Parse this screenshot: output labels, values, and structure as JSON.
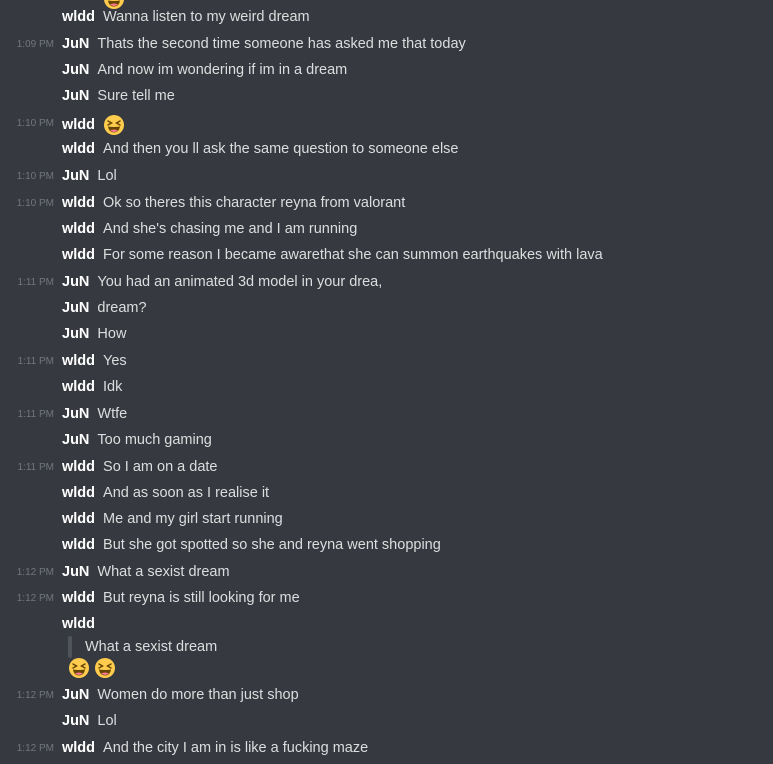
{
  "messages": [
    {
      "time": "",
      "author": "wldd",
      "text": "Wanna listen to my weird dream"
    },
    {
      "time": "1:09 PM",
      "author": "JuN",
      "text": "Thats the second time someone has asked me that today"
    },
    {
      "time": "",
      "author": "JuN",
      "text": "And now im wondering if im in a dream"
    },
    {
      "time": "",
      "author": "JuN",
      "text": "Sure tell me"
    },
    {
      "time": "1:10 PM",
      "author": "wldd",
      "text": ""
    },
    {
      "time": "",
      "author": "wldd",
      "text": "And then you ll ask the same question to someone else"
    },
    {
      "time": "1:10 PM",
      "author": "JuN",
      "text": "Lol"
    },
    {
      "time": "1:10 PM",
      "author": "wldd",
      "text": "Ok so theres this character reyna from valorant"
    },
    {
      "time": "",
      "author": "wldd",
      "text": "And she's chasing me and I am running"
    },
    {
      "time": "",
      "author": "wldd",
      "text": "For some reason I became awarethat she can summon earthquakes with lava"
    },
    {
      "time": "1:11 PM",
      "author": "JuN",
      "text": "You had an animated 3d model in your drea,"
    },
    {
      "time": "",
      "author": "JuN",
      "text": "dream?"
    },
    {
      "time": "",
      "author": "JuN",
      "text": "How"
    },
    {
      "time": "1:11 PM",
      "author": "wldd",
      "text": "Yes"
    },
    {
      "time": "",
      "author": "wldd",
      "text": "Idk"
    },
    {
      "time": "1:11 PM",
      "author": "JuN",
      "text": "Wtfe"
    },
    {
      "time": "",
      "author": "JuN",
      "text": "Too much gaming"
    },
    {
      "time": "1:11 PM",
      "author": "wldd",
      "text": "So I am on a date"
    },
    {
      "time": "",
      "author": "wldd",
      "text": "And as soon as I realise it"
    },
    {
      "time": "",
      "author": "wldd",
      "text": "Me and my girl start running"
    },
    {
      "time": "",
      "author": "wldd",
      "text": "But she got spotted so she and reyna went shopping"
    },
    {
      "time": "1:12 PM",
      "author": "JuN",
      "text": "What a sexist dream"
    },
    {
      "time": "1:12 PM",
      "author": "wldd",
      "text": "But reyna is still looking for me"
    },
    {
      "time": "",
      "author": "wldd",
      "text": ""
    },
    {
      "time": "1:12 PM",
      "author": "JuN",
      "text": "Women do more than just shop"
    },
    {
      "time": "",
      "author": "JuN",
      "text": "Lol"
    },
    {
      "time": "1:12 PM",
      "author": "wldd",
      "text": "And the city I am in is like a fucking maze"
    }
  ],
  "quote": {
    "text": "What a sexist dream"
  },
  "emoji": {
    "name": "laughing-emoji",
    "color": "#ffcc4d"
  }
}
